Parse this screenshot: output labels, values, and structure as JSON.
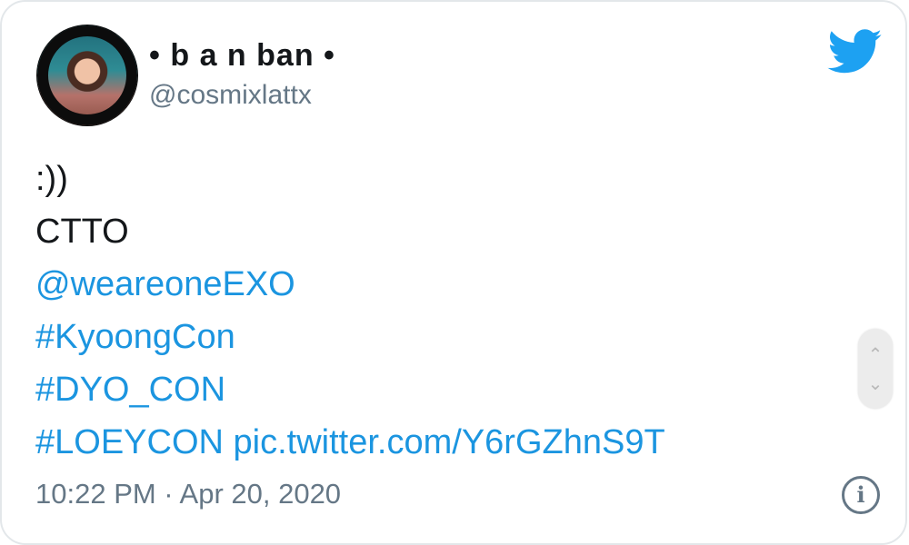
{
  "author": {
    "display_name": "• b a n ban •",
    "handle": "@cosmixlattx"
  },
  "tweet": {
    "lines": [
      {
        "text": ":))",
        "type": "text"
      },
      {
        "text": "CTTO",
        "type": "text"
      },
      {
        "text": "@weareoneEXO",
        "type": "mention"
      },
      {
        "text": "#KyoongCon",
        "type": "hashtag"
      },
      {
        "text": "#DYO_CON",
        "type": "hashtag"
      }
    ],
    "last_line_hashtag": "#LOEYCON",
    "last_line_link": "pic.twitter.com/Y6rGZhnS9T"
  },
  "meta": {
    "timestamp": "10:22 PM · Apr 20, 2020"
  },
  "icons": {
    "logo": "twitter-bird-icon",
    "info": "info-icon",
    "scroll_up": "chevron-up-icon",
    "scroll_down": "chevron-down-icon"
  },
  "colors": {
    "link": "#1b95e0",
    "brand": "#1da1f2",
    "text": "#14171a",
    "secondary": "#657786"
  },
  "glyphs": {
    "info": "i",
    "up": "⌃",
    "down": "⌄"
  }
}
